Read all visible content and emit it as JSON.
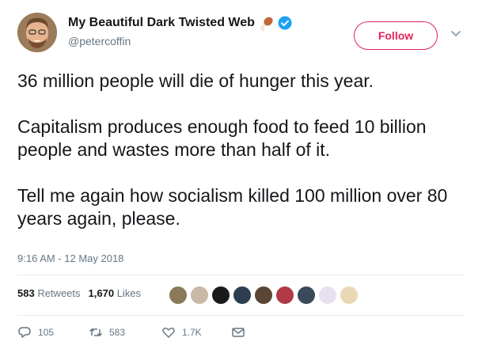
{
  "author": {
    "display_name": "My Beautiful Dark Twisted Web",
    "handle": "@petercoffin",
    "avatar_icon": "user-avatar"
  },
  "follow_label": "Follow",
  "tweet_text": "36 million people will die of hunger this year.\n\nCapitalism produces enough food to feed 10 billion people and wastes more than half of it.\n\nTell me again how socialism killed 100 million over 80 years again, please.",
  "timestamp": "9:16 AM - 12 May 2018",
  "stats": {
    "retweets_count": "583",
    "retweets_label": "Retweets",
    "likes_count": "1,670",
    "likes_label": "Likes"
  },
  "actions": {
    "replies": "105",
    "retweets": "583",
    "likes": "1.7K"
  },
  "colors": {
    "accent_follow": "#e0245e",
    "verified": "#1da1f2",
    "muted": "#657786"
  },
  "liker_avatars": [
    "#8a7a5a",
    "#c9b8a6",
    "#1a1a1a",
    "#2c3e50",
    "#5b4636",
    "#b03a48",
    "#3b4a5a",
    "#e8e0f0",
    "#e9d8b4"
  ]
}
